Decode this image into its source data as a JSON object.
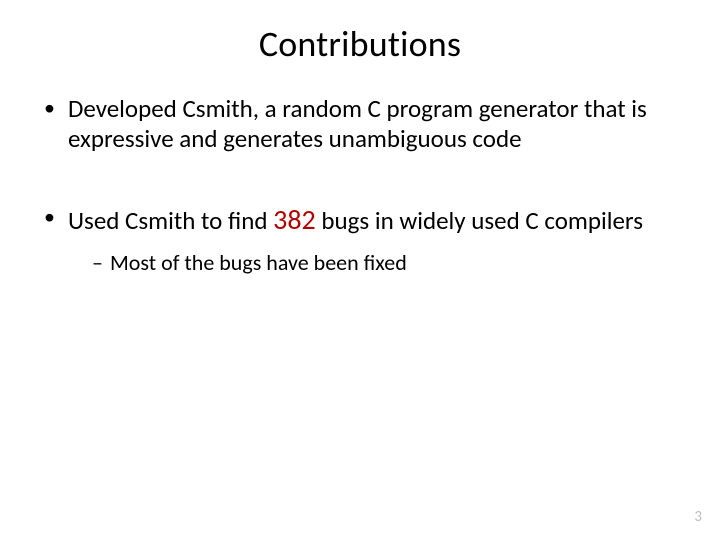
{
  "title": "Contributions",
  "bullets": {
    "b1": "Developed Csmith, a random C program generator that is expressive and generates unambiguous code",
    "b2_pre": "Used Csmith to find ",
    "b2_count": "382",
    "b2_post": " bugs in widely used C compilers",
    "b2_sub1": "Most of the bugs have been fixed"
  },
  "page_number": "3"
}
